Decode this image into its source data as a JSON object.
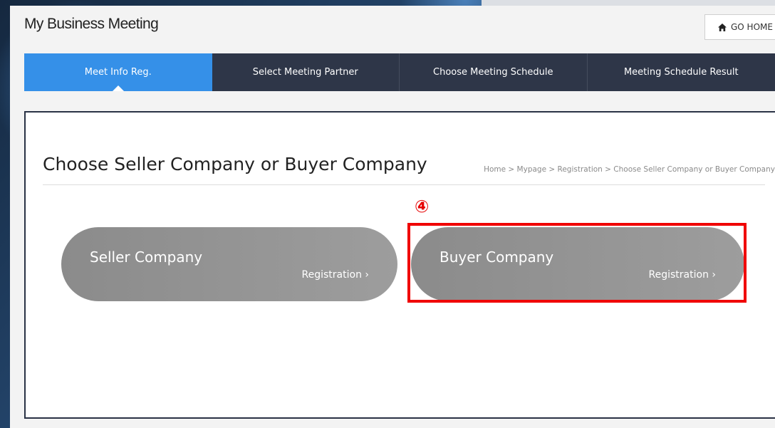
{
  "app": {
    "title": "My Business Meeting"
  },
  "header": {
    "go_home_label": "GO HOME"
  },
  "nav": {
    "tabs": [
      {
        "label": "Meet Info Reg.",
        "active": true
      },
      {
        "label": "Select Meeting Partner",
        "active": false
      },
      {
        "label": "Choose Meeting Schedule",
        "active": false
      },
      {
        "label": "Meeting Schedule Result",
        "active": false
      }
    ]
  },
  "page": {
    "title": "Choose Seller Company or Buyer Company",
    "breadcrumb": "Home > Mypage > Registration > Choose Seller Company or Buyer Company"
  },
  "annotation": {
    "step_marker": "④"
  },
  "cards": {
    "seller": {
      "name": "Seller Company",
      "action": "Registration ›"
    },
    "buyer": {
      "name": "Buyer Company",
      "action": "Registration ›"
    }
  },
  "colors": {
    "nav_bg": "#2e3648",
    "nav_active": "#3590e8",
    "card_bg": "#9a9a9a",
    "highlight": "#f00000"
  },
  "icons": {
    "home": "home-icon"
  }
}
